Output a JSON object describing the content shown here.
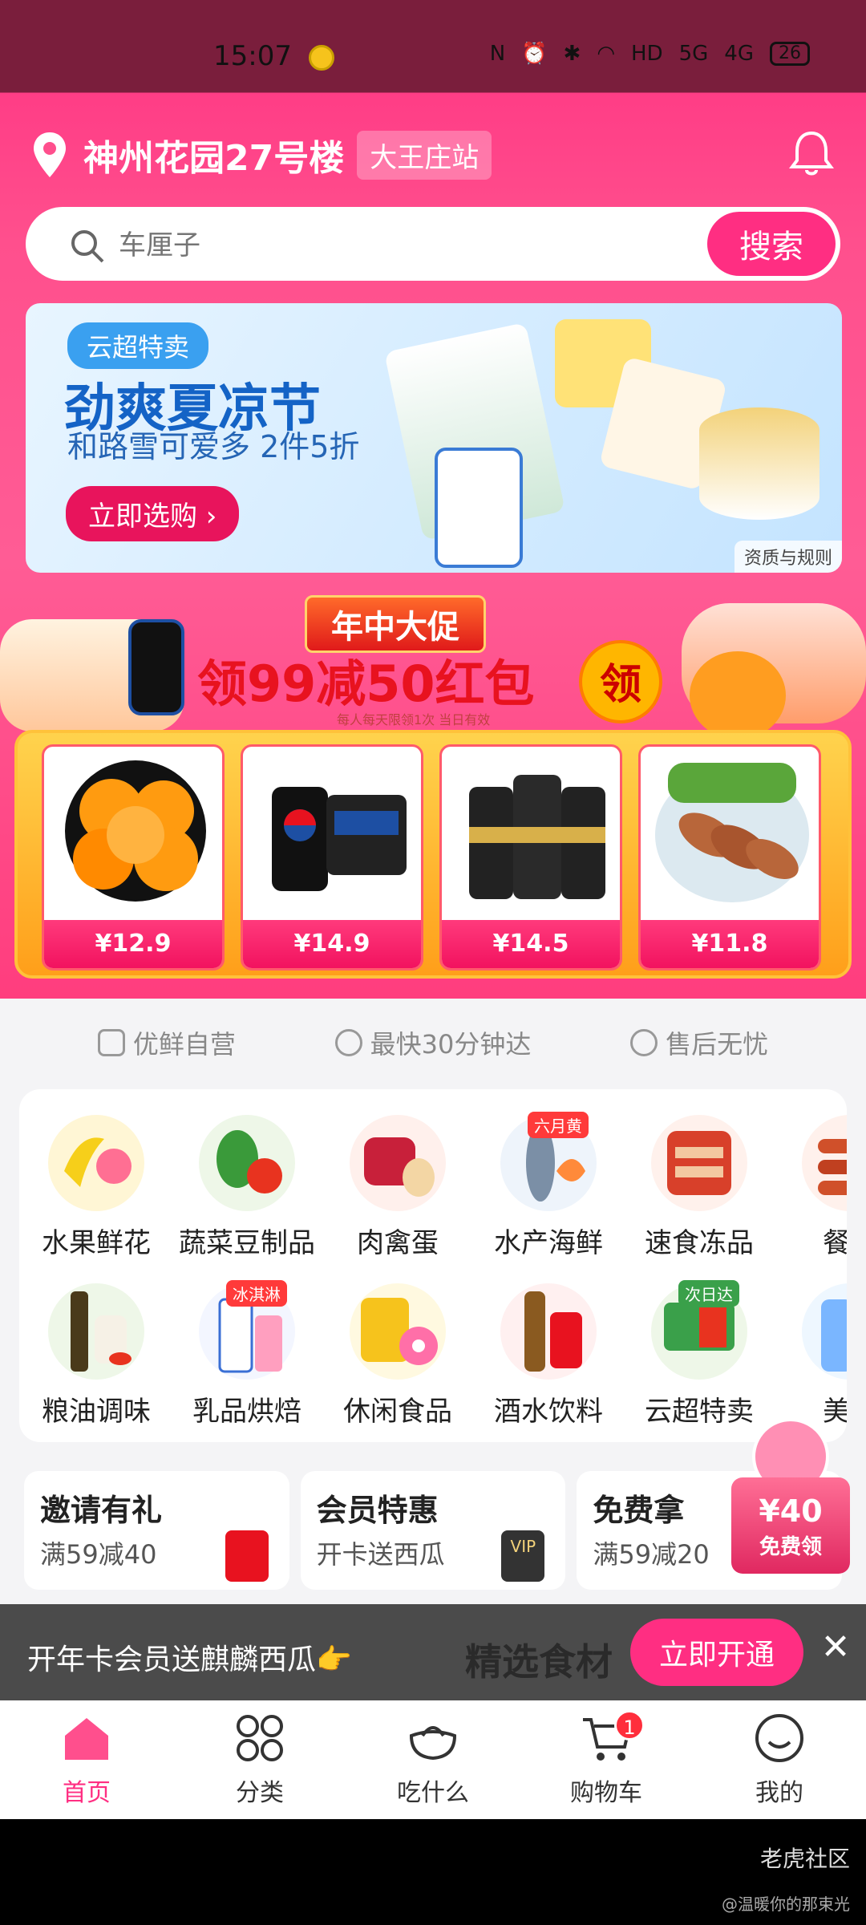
{
  "status": {
    "time": "15:07",
    "network1": "5G",
    "network2": "4G",
    "battery": "26",
    "hd": "HD"
  },
  "header": {
    "location": "神州花园27号楼",
    "station": "大王庄站"
  },
  "search": {
    "placeholder": "车厘子",
    "button": "搜索"
  },
  "banner": {
    "tag": "云超特卖",
    "title": "劲爽夏凉节",
    "subtitle": "和路雪可爱多 2件5折",
    "cta": "立即选购 ›",
    "rules": "资质与规则"
  },
  "promo": {
    "top": "年中大促",
    "title": "领99减50红包",
    "badge": "领",
    "note": "每人每天限领1次 当日有效",
    "goods": [
      {
        "name": "orange",
        "price": "¥12.9"
      },
      {
        "name": "pepsi",
        "price": "¥14.9"
      },
      {
        "name": "watsons",
        "price": "¥14.5"
      },
      {
        "name": "chicken",
        "price": "¥11.8"
      }
    ]
  },
  "assurances": [
    "优鲜自营",
    "最快30分钟达",
    "售后无忧"
  ],
  "categories": {
    "row1": [
      {
        "label": "水果鲜花"
      },
      {
        "label": "蔬菜豆制品"
      },
      {
        "label": "肉禽蛋"
      },
      {
        "label": "水产海鲜",
        "flag": "六月黄"
      },
      {
        "label": "速食冻品"
      },
      {
        "label": "餐饮"
      }
    ],
    "row2": [
      {
        "label": "粮油调味"
      },
      {
        "label": "乳品烘焙",
        "flag": "冰淇淋"
      },
      {
        "label": "休闲食品"
      },
      {
        "label": "酒水饮料"
      },
      {
        "label": "云超特卖",
        "flag": "次日达"
      },
      {
        "label": "美护"
      }
    ]
  },
  "cards": [
    {
      "title": "邀请有礼",
      "sub": "满59减40"
    },
    {
      "title": "会员特惠",
      "sub": "开卡送西瓜",
      "deco": "VIP"
    },
    {
      "title": "免费拿",
      "sub": "满59减20"
    }
  ],
  "floating": {
    "amount": "¥40",
    "label": "免费领"
  },
  "member_strip": {
    "text": "开年卡会员送麒麟西瓜👉",
    "behind": "精选食材",
    "button": "立即开通",
    "close": "✕"
  },
  "tabs": [
    {
      "label": "首页",
      "icon": "home-icon"
    },
    {
      "label": "分类",
      "icon": "grid-icon"
    },
    {
      "label": "吃什么",
      "icon": "bowl-icon"
    },
    {
      "label": "购物车",
      "icon": "cart-icon",
      "badge": "1"
    },
    {
      "label": "我的",
      "icon": "smile-icon"
    }
  ],
  "watermark": {
    "brand": "老虎社区",
    "user": "@温暖你的那束光"
  },
  "colors": {
    "accent": "#ff2e82",
    "header_pink": "#ff4f8d",
    "banner_blue": "#1463c6"
  }
}
